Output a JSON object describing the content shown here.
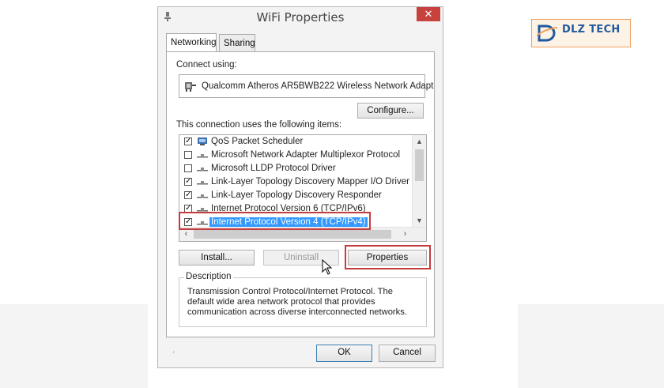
{
  "window": {
    "title": "WiFi Properties",
    "close": "✕"
  },
  "tabs": [
    {
      "label": "Networking",
      "active": true
    },
    {
      "label": "Sharing",
      "active": false
    }
  ],
  "connect_using": {
    "label": "Connect using:",
    "adapter": "Qualcomm Atheros AR5BWB222 Wireless Network Adapt",
    "configure": "Configure..."
  },
  "items": {
    "label": "This connection uses the following items:",
    "list": [
      {
        "checked": true,
        "label": "QoS Packet Scheduler",
        "icon": "qos-icon"
      },
      {
        "checked": false,
        "label": "Microsoft Network Adapter Multiplexor Protocol",
        "icon": "protocol-icon"
      },
      {
        "checked": false,
        "label": "Microsoft LLDP Protocol Driver",
        "icon": "protocol-icon"
      },
      {
        "checked": true,
        "label": "Link-Layer Topology Discovery Mapper I/O Driver",
        "icon": "protocol-icon"
      },
      {
        "checked": true,
        "label": "Link-Layer Topology Discovery Responder",
        "icon": "protocol-icon"
      },
      {
        "checked": true,
        "label": "Internet Protocol Version 6 (TCP/IPv6)",
        "icon": "protocol-icon"
      },
      {
        "checked": true,
        "label": "Internet Protocol Version 4 (TCP/IPv4)",
        "icon": "protocol-icon",
        "selected": true
      }
    ],
    "check_mark": "✓"
  },
  "buttons": {
    "install": "Install...",
    "uninstall": "Uninstall",
    "properties": "Properties",
    "ok": "OK",
    "cancel": "Cancel"
  },
  "description": {
    "legend": "Description",
    "text": "Transmission Control Protocol/Internet Protocol. The default wide area network protocol that provides communication across diverse interconnected networks."
  },
  "logo": {
    "text": "DLZ TECH",
    "brand_color": "#1f5a9e",
    "accent_color": "#f0a060"
  },
  "colors": {
    "highlight": "#c43b3b",
    "selection": "#3399ff",
    "close": "#c7413d"
  }
}
